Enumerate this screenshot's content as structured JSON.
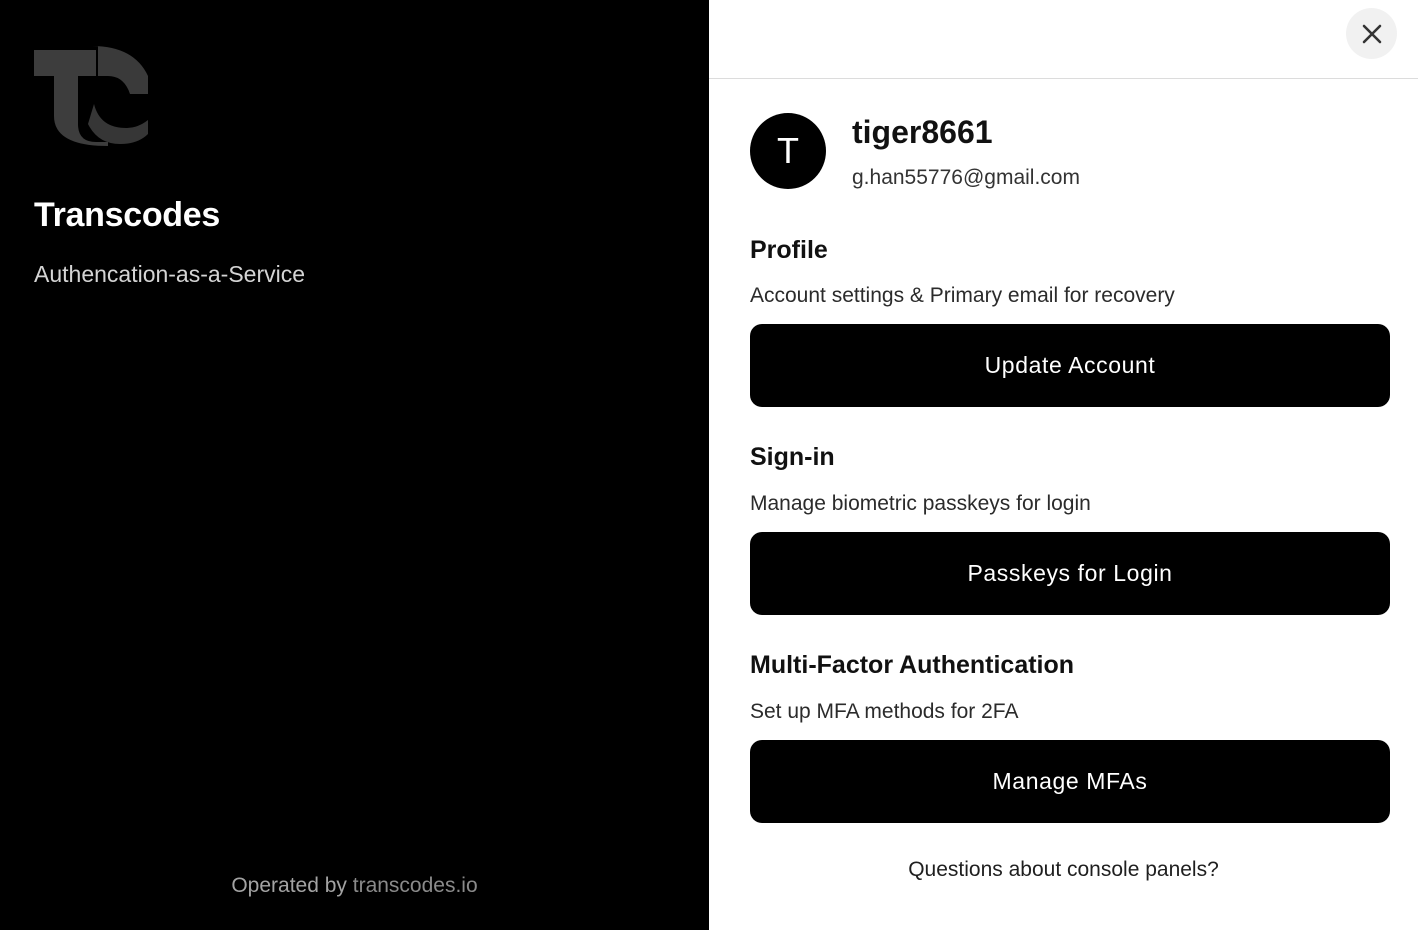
{
  "brand": {
    "logo_icon": "transcodes-tc-logo-icon",
    "name": "Transcodes",
    "tagline": "Authencation-as-a-Service",
    "operated_by_prefix": "Operated by ",
    "operated_by_link": "transcodes.io"
  },
  "header": {
    "close_icon": "close-icon"
  },
  "user": {
    "avatar_initial": "T",
    "username": "tiger8661",
    "email": "g.han55776@gmail.com"
  },
  "sections": {
    "profile": {
      "title": "Profile",
      "description": "Account settings & Primary email for recovery",
      "button_label": "Update Account"
    },
    "signin": {
      "title": "Sign-in",
      "description": "Manage biometric passkeys for login",
      "button_label": "Passkeys for Login"
    },
    "mfa": {
      "title": "Multi-Factor Authentication",
      "description": "Set up MFA methods for 2FA",
      "button_label": "Manage MFAs"
    }
  },
  "footer": {
    "help_text": "Questions about console panels?"
  },
  "colors": {
    "left_background": "#000000",
    "button_background": "#000000",
    "button_text": "#ffffff",
    "close_button_background": "#f1f1f1"
  }
}
